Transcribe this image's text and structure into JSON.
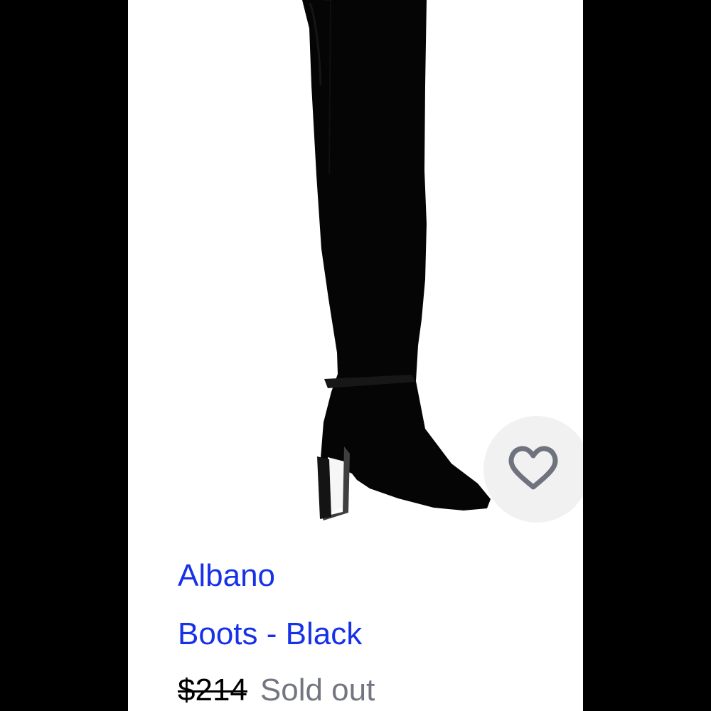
{
  "colors": {
    "background": "#000000",
    "card": "#ffffff",
    "product_link": "#1631e8",
    "price": "#000000",
    "status": "#737580",
    "favorite_background": "#f1f1f2",
    "favorite_icon": "#6f737e"
  },
  "product": {
    "brand": "Albano",
    "name": "Boots - Black",
    "original_price": "$214",
    "status": "Sold out",
    "image_icon": "black-over-the-knee-boot"
  },
  "actions": {
    "favorite_icon": "heart-outline-icon"
  }
}
